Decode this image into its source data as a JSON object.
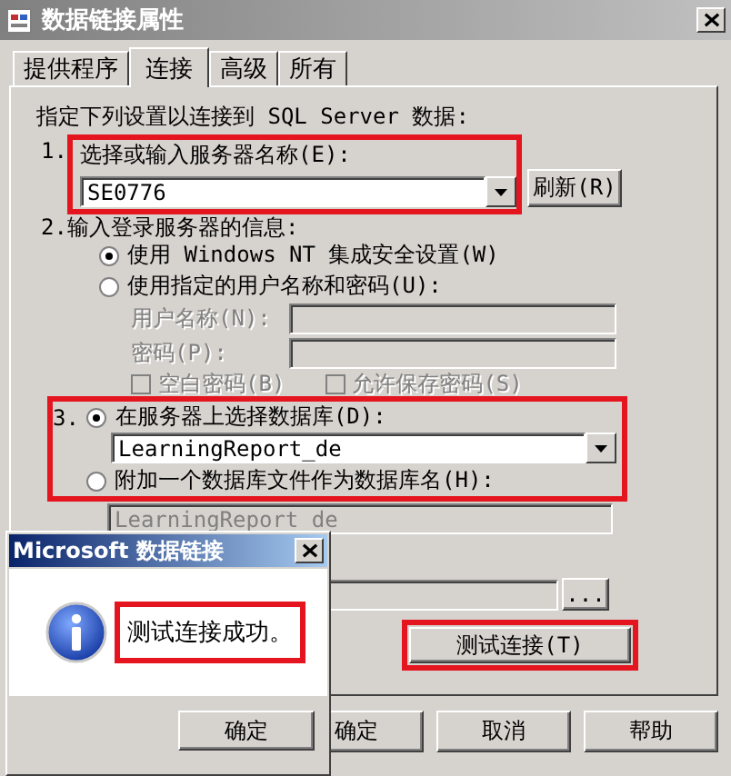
{
  "window": {
    "title": "数据链接属性"
  },
  "tabs": [
    {
      "label": "提供程序",
      "selected": false
    },
    {
      "label": "连接",
      "selected": true
    },
    {
      "label": "高级",
      "selected": false
    },
    {
      "label": "所有",
      "selected": false
    }
  ],
  "intro": "指定下列设置以连接到 SQL Server 数据:",
  "step1": {
    "number": "1.",
    "label": "选择或输入服务器名称(E):",
    "server": "SE0776",
    "refresh_button": "刷新(R)",
    "highlighted": true
  },
  "step2": {
    "number": "2.",
    "label": "输入登录服务器的信息:",
    "options": [
      {
        "label": "使用 Windows NT 集成安全设置(W)",
        "selected": true
      },
      {
        "label": "使用指定的用户名称和密码(U):",
        "selected": false
      }
    ],
    "username_label": "用户名称(N):",
    "password_label": "密码(P):",
    "disabled": true,
    "checkboxes": [
      {
        "label": "空白密码(B)",
        "checked": false
      },
      {
        "label": "允许保存密码(S)",
        "checked": false
      }
    ]
  },
  "step3": {
    "number": "3.",
    "highlighted": true,
    "options": [
      {
        "label": "在服务器上选择数据库(D):",
        "selected": true
      },
      {
        "label": "附加一个数据库文件作为数据库名(H):",
        "selected": false
      }
    ],
    "database": "LearningReport_de",
    "attach_name": "LearningReport_de",
    "browse_button": "..."
  },
  "test_button": {
    "label": "测试连接(T)",
    "highlighted": true
  },
  "buttons": [
    "确定",
    "取消",
    "帮助"
  ],
  "message_box": {
    "title": "Microsoft 数据链接",
    "message": "测试连接成功。",
    "highlighted": true,
    "button": "确定"
  }
}
